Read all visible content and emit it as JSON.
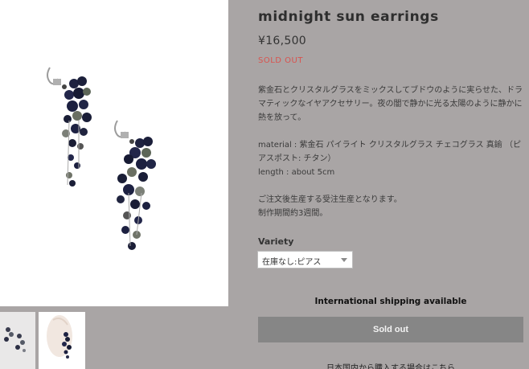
{
  "product": {
    "title": "midnight sun earrings",
    "price": "¥16,500",
    "status": "SOLD OUT",
    "description": "紫金石とクリスタルグラスをミックスしてブドウのように実らせた、ドラマティックなイヤアクセサリー。夜の闇で静かに光る太陽のように静かに熱を放って。",
    "material": "material : 紫金石 パイライト クリスタルグラス チェコグラス 真鍮 （ピアスポスト: チタン）",
    "length": "length : about 5cm",
    "note1": "ご注文後生産する受注生産となります。",
    "note2": "制作期間約3週間。"
  },
  "variety": {
    "label": "Variety",
    "selected": "在庫なし:ピアス"
  },
  "shipping": "International shipping available",
  "sold_button": "Sold out",
  "domestic_link": "日本国内から購入する場合はこちら",
  "icons": [
    "main-product-image",
    "thumbnail-earrings-detail",
    "thumbnail-earrings-worn"
  ],
  "colors": {
    "background": "#a9a5a5",
    "sold": "#d9534f",
    "button": "#868686"
  }
}
